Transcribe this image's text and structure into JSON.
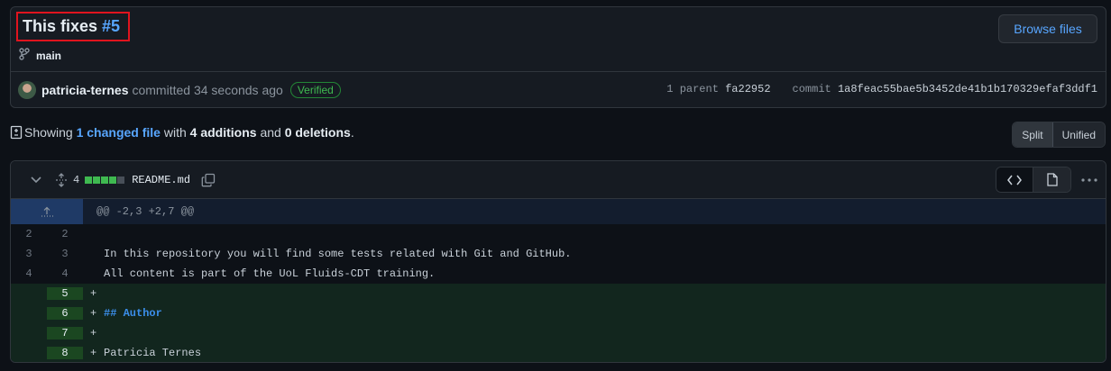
{
  "commit": {
    "title": "This fixes",
    "issue_ref": "#5",
    "branch": "main",
    "browse_label": "Browse files",
    "author": "patricia-ternes",
    "action": "committed 34 seconds ago",
    "badge": "Verified",
    "parent_label": "1 parent",
    "parent_sha": "fa22952",
    "commit_label": "commit",
    "commit_sha": "1a8feac55bae5b3452de41b1b170329efaf3ddf1"
  },
  "summary": {
    "prefix": "Showing",
    "changed": "1 changed file",
    "with": "with",
    "additions": "4 additions",
    "and": "and",
    "deletions": "0 deletions",
    "suffix": "."
  },
  "view_toggle": {
    "split": "Split",
    "unified": "Unified"
  },
  "file": {
    "change_count": "4",
    "name": "README.md",
    "hunk": "@@ -2,3 +2,7 @@",
    "lines": [
      {
        "old": "2",
        "new": "2",
        "marker": "",
        "text": ""
      },
      {
        "old": "3",
        "new": "3",
        "marker": "",
        "text": "In this repository you will find some tests related with Git and GitHub."
      },
      {
        "old": "4",
        "new": "4",
        "marker": "",
        "text": "All content is part of the UoL Fluids-CDT training."
      },
      {
        "old": "",
        "new": "5",
        "marker": "+",
        "text": ""
      },
      {
        "old": "",
        "new": "6",
        "marker": "+",
        "text": "## Author"
      },
      {
        "old": "",
        "new": "7",
        "marker": "+",
        "text": ""
      },
      {
        "old": "",
        "new": "8",
        "marker": "+",
        "text": "Patricia Ternes"
      }
    ]
  },
  "colors": {
    "accent": "#58a6ff",
    "added_bg": "#12261e",
    "added_gutter": "#1b4721",
    "highlight_border": "#e0141e"
  }
}
